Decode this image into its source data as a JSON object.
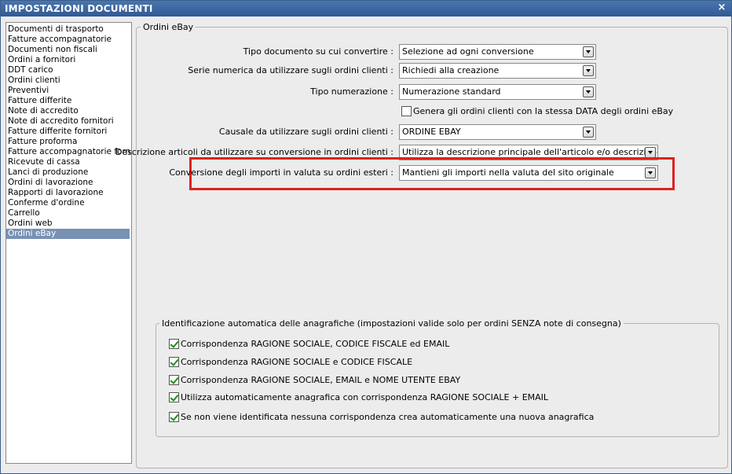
{
  "window": {
    "title": "IMPOSTAZIONI DOCUMENTI",
    "close_icon": "×"
  },
  "sidebar": {
    "items": [
      "Documenti di trasporto",
      "Fatture accompagnatorie",
      "Documenti non fiscali",
      "Ordini a fornitori",
      "DDT carico",
      "Ordini clienti",
      "Preventivi",
      "Fatture differite",
      "Note di accredito",
      "Note di accredito fornitori",
      "Fatture differite fornitori",
      "Fatture proforma",
      "Fatture accompagnatorie fornito",
      "Ricevute di cassa",
      "Lanci di produzione",
      "Ordini di lavorazione",
      "Rapporti di lavorazione",
      "Conferme d'ordine",
      "Carrello",
      "Ordini web",
      "Ordini eBay"
    ],
    "selected": "Ordini eBay"
  },
  "main": {
    "group_title": "Ordini eBay",
    "fields": {
      "tipo_documento": {
        "label": "Tipo documento su cui convertire :",
        "value": "Selezione ad ogni conversione"
      },
      "serie_numerica": {
        "label": "Serie numerica da utilizzare sugli ordini clienti :",
        "value": "Richiedi alla creazione"
      },
      "tipo_numerazione": {
        "label": "Tipo numerazione :",
        "value": "Numerazione standard"
      },
      "genera_data": {
        "label": "Genera gli ordini clienti con la stessa DATA degli ordini eBay",
        "checked": false
      },
      "causale": {
        "label": "Causale da utilizzare sugli ordini clienti :",
        "value": "ORDINE EBAY"
      },
      "descrizione": {
        "label": "Descrizione articoli da utilizzare su conversione in ordini clienti :",
        "value": "Utilizza la descrizione principale dell'articolo e/o descrizione docu"
      },
      "conversione_valuta": {
        "label": "Conversione degli importi in valuta su ordini esteri :",
        "value": "Mantieni gli importi nella valuta del sito originale"
      }
    },
    "highlight_color": "#e02020"
  },
  "identificazione": {
    "title": "Identificazione automatica delle anagrafiche (impostazioni valide solo per ordini SENZA note di consegna)",
    "options": [
      {
        "label": "Corrispondenza RAGIONE SOCIALE, CODICE FISCALE ed EMAIL",
        "checked": true
      },
      {
        "label": "Corrispondenza RAGIONE SOCIALE e CODICE FISCALE",
        "checked": true
      },
      {
        "label": "Corrispondenza RAGIONE SOCIALE, EMAIL e NOME UTENTE EBAY",
        "checked": true
      },
      {
        "label": "Utilizza automaticamente anagrafica con corrispondenza RAGIONE SOCIALE + EMAIL",
        "checked": true
      },
      {
        "label": "Se non viene identificata nessuna corrispondenza crea automaticamente una nuova anagrafica",
        "checked": true
      }
    ]
  }
}
